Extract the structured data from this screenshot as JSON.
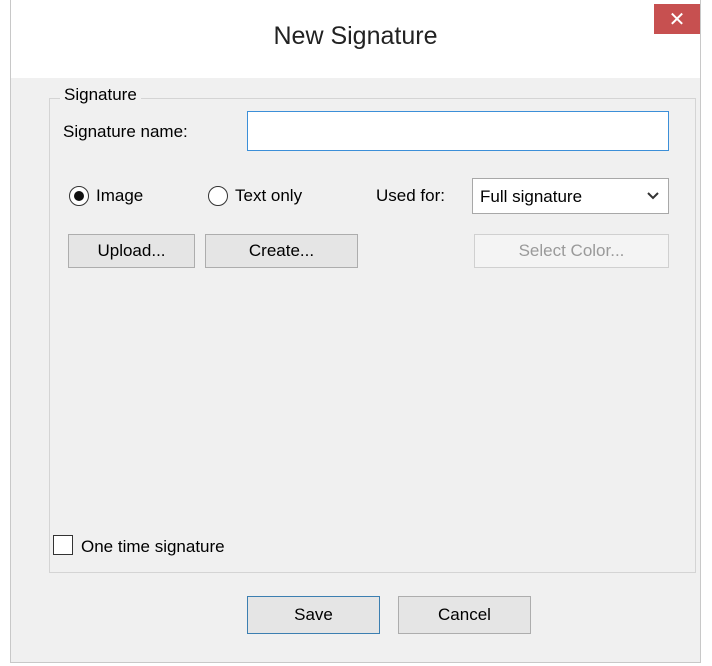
{
  "window": {
    "title": "New Signature",
    "close_glyph": "✕"
  },
  "group": {
    "legend": "Signature"
  },
  "signature_name": {
    "label": "Signature name:",
    "value": "",
    "placeholder": ""
  },
  "type_options": {
    "image_label": "Image",
    "text_only_label": "Text only",
    "selected": "Image"
  },
  "used_for": {
    "label": "Used for:",
    "value": "Full signature"
  },
  "buttons": {
    "upload": "Upload...",
    "create": "Create...",
    "select_color": "Select Color...",
    "save": "Save",
    "cancel": "Cancel"
  },
  "one_time": {
    "label": "One time signature",
    "checked": false
  },
  "icons": {
    "close": "close-icon",
    "chevron": "chevron-down-icon"
  },
  "colors": {
    "close_bg": "#c75050",
    "input_focus_border": "#3c8fd8",
    "default_button_border": "#3c7fb1",
    "disabled_text": "#9a9a9a"
  }
}
